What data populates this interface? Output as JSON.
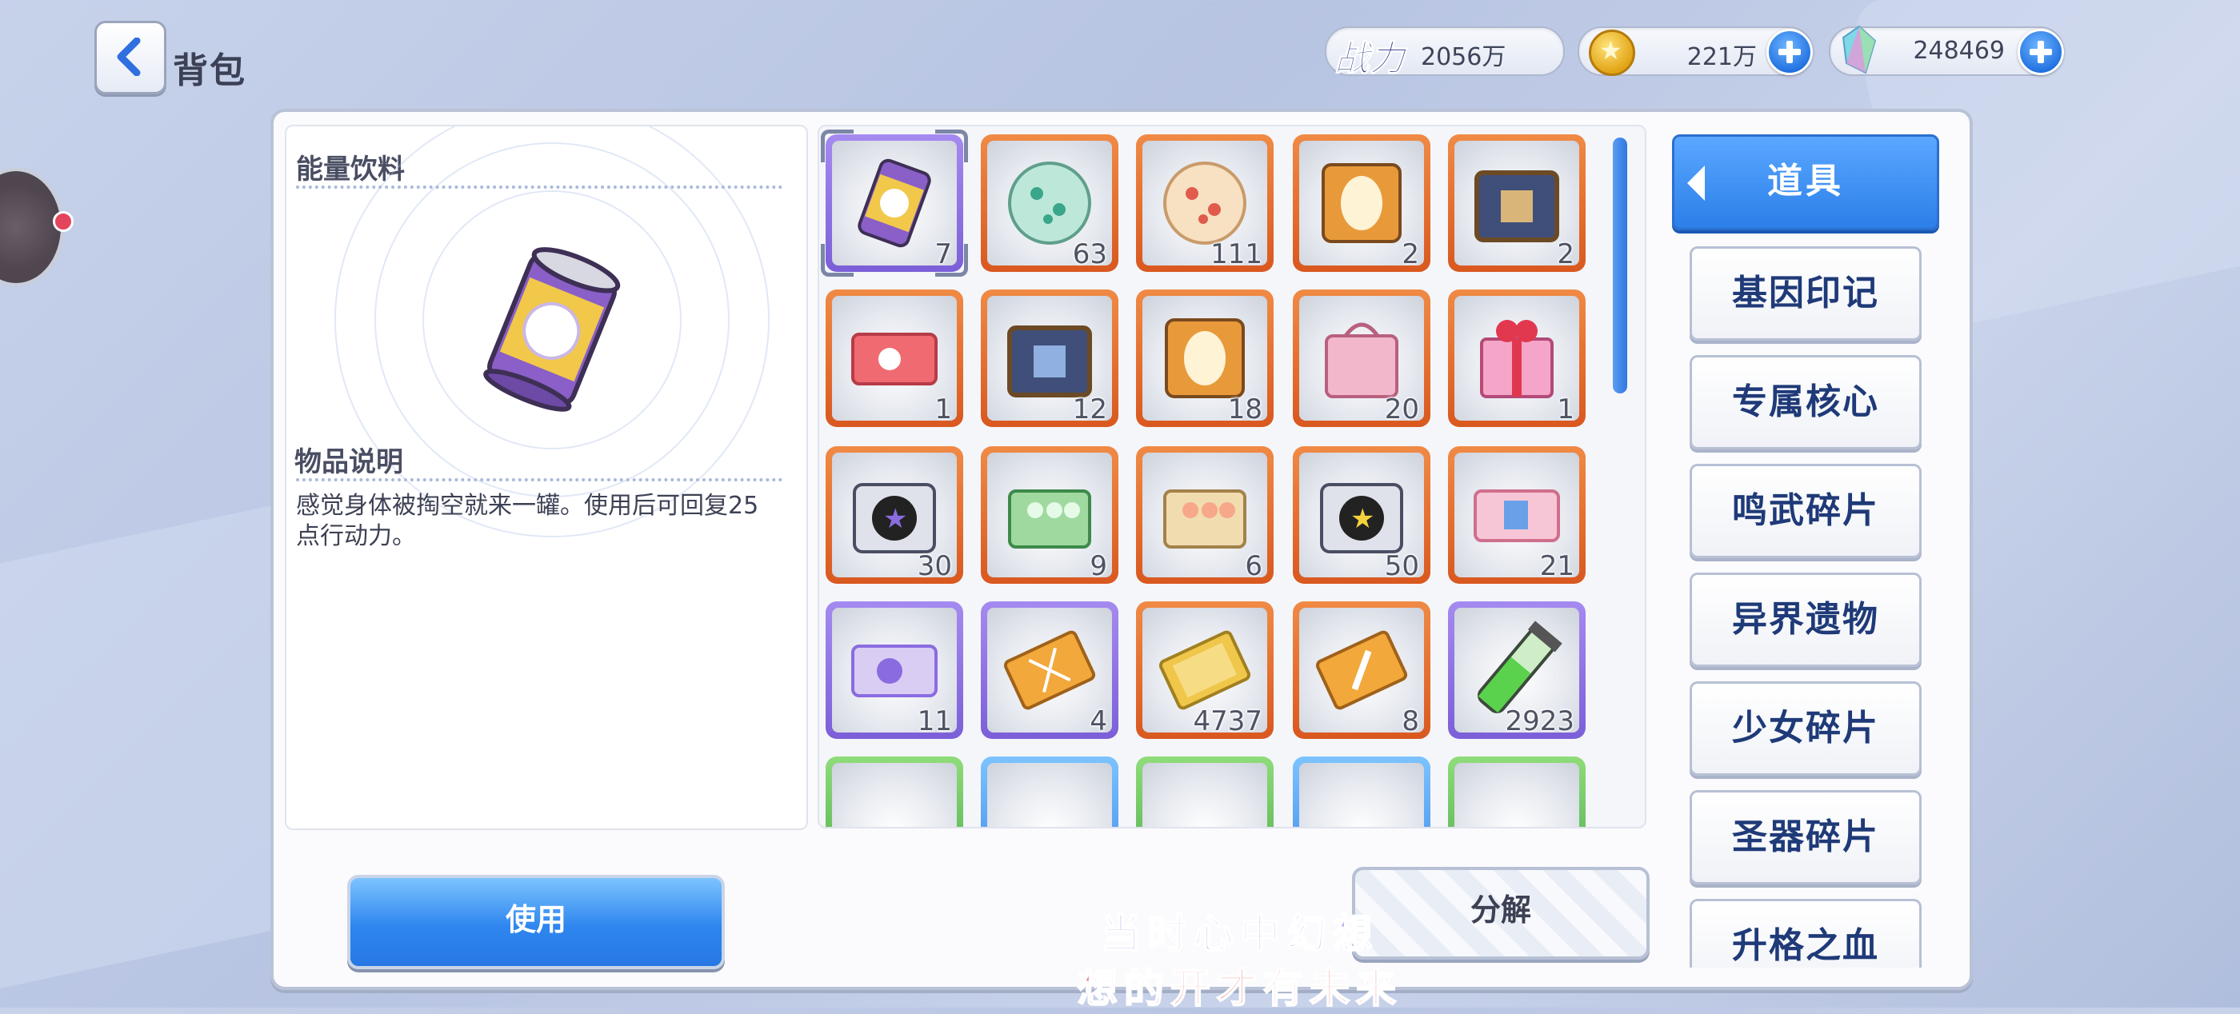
{
  "header": {
    "title": "背包",
    "power_badge": "战力",
    "power_value": "2056万",
    "gold_value": "221万",
    "gem_value": "248469"
  },
  "detail": {
    "item_name": "能量饮料",
    "desc_title": "物品说明",
    "desc_text": "感觉身体被掏空就来一罐。使用后可回复25点行动力。"
  },
  "actions": {
    "use_label": "使用",
    "decompose_label": "分解"
  },
  "tabs": {
    "active": "道具",
    "items": [
      "基因印记",
      "专属核心",
      "鸣武碎片",
      "异界遗物",
      "少女碎片",
      "圣器碎片",
      "升格之血"
    ]
  },
  "grid": {
    "items": [
      {
        "name": "energy-drink",
        "count": "7",
        "rarity": "purple",
        "selected": true
      },
      {
        "name": "green-orb",
        "count": "63",
        "rarity": "orange"
      },
      {
        "name": "red-orb",
        "count": "111",
        "rarity": "orange"
      },
      {
        "name": "glowing-box",
        "count": "2",
        "rarity": "orange"
      },
      {
        "name": "treasure-chest",
        "count": "2",
        "rarity": "orange"
      },
      {
        "name": "red-ticket",
        "count": "1",
        "rarity": "orange"
      },
      {
        "name": "chest",
        "count": "12",
        "rarity": "orange"
      },
      {
        "name": "glowing-box",
        "count": "18",
        "rarity": "orange"
      },
      {
        "name": "pink-gift-bag",
        "count": "20",
        "rarity": "orange"
      },
      {
        "name": "ribbon-gift",
        "count": "1",
        "rarity": "orange"
      },
      {
        "name": "purple-star-box",
        "count": "30",
        "rarity": "orange"
      },
      {
        "name": "green-crate",
        "count": "9",
        "rarity": "orange"
      },
      {
        "name": "beige-crate",
        "count": "6",
        "rarity": "orange"
      },
      {
        "name": "yellow-star-box",
        "count": "50",
        "rarity": "orange"
      },
      {
        "name": "pink-ticket",
        "count": "21",
        "rarity": "orange"
      },
      {
        "name": "purple-ticket",
        "count": "11",
        "rarity": "purple"
      },
      {
        "name": "dna-card",
        "count": "4",
        "rarity": "purple"
      },
      {
        "name": "gold-card",
        "count": "4737",
        "rarity": "orange"
      },
      {
        "name": "sword-card",
        "count": "8",
        "rarity": "orange"
      },
      {
        "name": "green-vial",
        "count": "2923",
        "rarity": "purple"
      },
      {
        "name": "item",
        "count": "",
        "rarity": "green"
      },
      {
        "name": "item",
        "count": "",
        "rarity": "blue"
      },
      {
        "name": "item",
        "count": "",
        "rarity": "green"
      },
      {
        "name": "item",
        "count": "",
        "rarity": "blue"
      },
      {
        "name": "item",
        "count": "",
        "rarity": "green"
      }
    ]
  },
  "overlay_subtitle": {
    "line1": "当时心中幻想",
    "line2": "想的开才有未来"
  },
  "colors": {
    "orange_frame": "#e4692c",
    "purple_frame": "#8b6ce0",
    "accent_blue": "#2f86ee"
  }
}
